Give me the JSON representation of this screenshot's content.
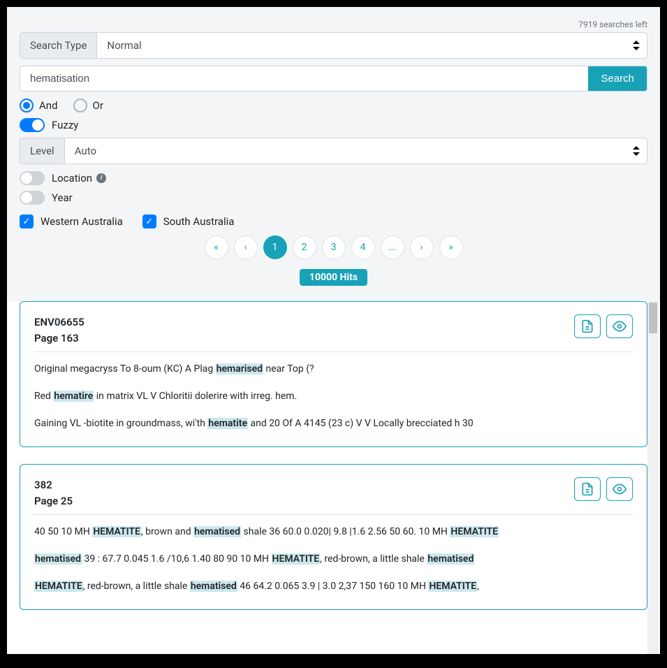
{
  "status": {
    "searches_left": "7919 searches left"
  },
  "search": {
    "type_label": "Search Type",
    "type_value": "Normal",
    "query": "hematisation",
    "button": "Search"
  },
  "options": {
    "and": "And",
    "or": "Or",
    "and_selected": true,
    "fuzzy_label": "Fuzzy",
    "fuzzy_on": true,
    "level_label": "Level",
    "level_value": "Auto",
    "location_label": "Location",
    "location_on": false,
    "year_label": "Year",
    "year_on": false
  },
  "regions": {
    "wa": "Western Australia",
    "sa": "South Australia"
  },
  "pagination": {
    "pages": [
      "«",
      "‹",
      "1",
      "2",
      "3",
      "4",
      "...",
      "›",
      "»"
    ],
    "active": "1"
  },
  "hits": "10000 Hits",
  "results": [
    {
      "id": "ENV06655",
      "page": "Page 163",
      "snippets": [
        {
          "parts": [
            {
              "t": "Original megacryss To 8-oum (KC) A Plag "
            },
            {
              "t": "hemarised",
              "hl": true
            },
            {
              "t": " near Top (?"
            }
          ]
        },
        {
          "parts": [
            {
              "t": "Red "
            },
            {
              "t": "hematire",
              "hl": true
            },
            {
              "t": " in matrix VL V Chloritii dolerire with irreg. hem."
            }
          ]
        },
        {
          "parts": [
            {
              "t": "Gaining VL -biotite in groundmass, wi'th "
            },
            {
              "t": "hematite",
              "hl": true
            },
            {
              "t": " and 20 Of A 4145 (23 c) V V Locally brecciated h 30"
            }
          ]
        }
      ]
    },
    {
      "id": "382",
      "page": "Page 25",
      "snippets": [
        {
          "parts": [
            {
              "t": "40 50 10 MH "
            },
            {
              "t": "HEMATITE",
              "hl": true
            },
            {
              "t": ", brown and "
            },
            {
              "t": "hematised",
              "hl": true
            },
            {
              "t": " shale 36 60.0 0.020| 9.8 |1.6 2.56 50 60. 10 MH "
            },
            {
              "t": "HEMATITE",
              "hl": true
            }
          ]
        },
        {
          "parts": [
            {
              "t": "hematised",
              "hl": true
            },
            {
              "t": " 39 : 67.7 0.045 1.6 /10,6 1.40 80 90 10 MH "
            },
            {
              "t": "HEMATITE",
              "hl": true
            },
            {
              "t": ", red-brown, a little shale "
            },
            {
              "t": "hematised",
              "hl": true
            }
          ]
        },
        {
          "parts": [
            {
              "t": "HEMATITE",
              "hl": true
            },
            {
              "t": ", red-brown, a little shale "
            },
            {
              "t": "hematised",
              "hl": true
            },
            {
              "t": " 46 64.2 0.065 3.9 | 3.0 2,37 150 160 10 MH "
            },
            {
              "t": "HEMATITE",
              "hl": true
            },
            {
              "t": ","
            }
          ]
        }
      ]
    }
  ]
}
